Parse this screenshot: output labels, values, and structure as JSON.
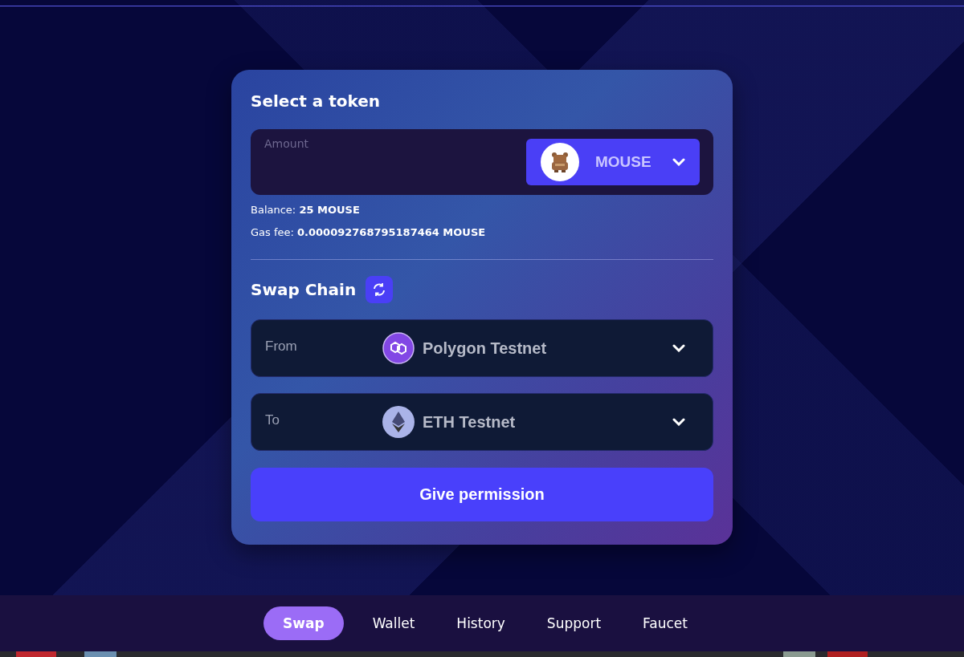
{
  "token_section": {
    "title": "Select a token",
    "amount": {
      "placeholder": "Amount"
    },
    "token_select": {
      "label": "MOUSE"
    },
    "balance": "Balance: **25 MOUSE**",
    "gas_fee": "Gas fee: **0.000092768795187464 MOUSE**"
  },
  "swap_chain": {
    "title": "Swap Chain",
    "selects": [
      {
        "label": "From",
        "value": "Polygon Testnet"
      },
      {
        "label": "To",
        "value": "ETH Testnet"
      }
    ]
  },
  "submit_button": "Give permission",
  "nav": [
    {
      "label": "Swap",
      "selected": true
    },
    {
      "label": "Wallet",
      "selected": false
    },
    {
      "label": "History",
      "selected": false
    },
    {
      "label": "Support",
      "selected": false
    },
    {
      "label": "Faucet",
      "selected": false
    }
  ]
}
